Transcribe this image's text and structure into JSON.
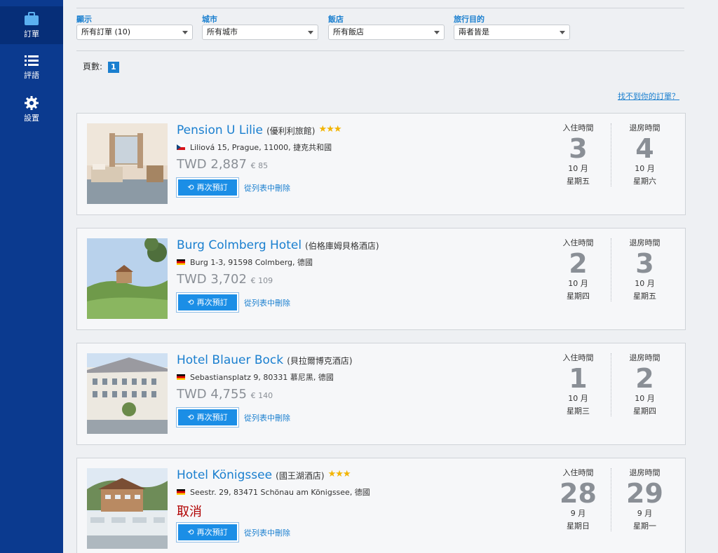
{
  "sidebar": {
    "items": [
      {
        "label": "訂單",
        "icon": "briefcase-icon"
      },
      {
        "label": "評語",
        "icon": "list-icon"
      },
      {
        "label": "設置",
        "icon": "gear-icon"
      }
    ]
  },
  "filters": [
    {
      "label": "顯示",
      "value": "所有訂單 (10)"
    },
    {
      "label": "城市",
      "value": "所有城市"
    },
    {
      "label": "飯店",
      "value": "所有飯店"
    },
    {
      "label": "旅行目的",
      "value": "兩者皆是"
    }
  ],
  "pagination": {
    "label": "頁數:",
    "current": "1"
  },
  "help_link": "找不到你的訂單？",
  "actions": {
    "rebook": "再次預訂",
    "remove": "從列表中刪除"
  },
  "date_labels": {
    "checkin": "入住時間",
    "checkout": "退房時間"
  },
  "bookings": [
    {
      "name": "Pension U Lilie",
      "name_local": "(優利利旅館)",
      "stars": "★★★",
      "flag": "cz",
      "address": "Liliová 15, Prague, 11000, 捷克共和國",
      "price": "TWD 2,887",
      "price_eur": "€ 85",
      "status": "",
      "checkin": {
        "day": "3",
        "month": "10 月",
        "weekday": "星期五"
      },
      "checkout": {
        "day": "4",
        "month": "10 月",
        "weekday": "星期六"
      }
    },
    {
      "name": "Burg Colmberg Hotel",
      "name_local": "(伯格庫姆貝格酒店)",
      "stars": "",
      "flag": "de",
      "address": "Burg 1-3, 91598 Colmberg, 德國",
      "price": "TWD 3,702",
      "price_eur": "€ 109",
      "status": "",
      "checkin": {
        "day": "2",
        "month": "10 月",
        "weekday": "星期四"
      },
      "checkout": {
        "day": "3",
        "month": "10 月",
        "weekday": "星期五"
      }
    },
    {
      "name": "Hotel Blauer Bock",
      "name_local": "(貝拉爾博克酒店)",
      "stars": "",
      "flag": "de",
      "address": "Sebastiansplatz 9, 80331 慕尼黑, 德國",
      "price": "TWD 4,755",
      "price_eur": "€ 140",
      "status": "",
      "checkin": {
        "day": "1",
        "month": "10 月",
        "weekday": "星期三"
      },
      "checkout": {
        "day": "2",
        "month": "10 月",
        "weekday": "星期四"
      }
    },
    {
      "name": "Hotel Königssee",
      "name_local": "(國王湖酒店)",
      "stars": "★★★",
      "flag": "de",
      "address": "Seestr. 29, 83471 Schönau am Königssee, 德國",
      "price": "",
      "price_eur": "",
      "status": "取消",
      "checkin": {
        "day": "28",
        "month": "9 月",
        "weekday": "星期日"
      },
      "checkout": {
        "day": "29",
        "month": "9 月",
        "weekday": "星期一"
      }
    }
  ]
}
